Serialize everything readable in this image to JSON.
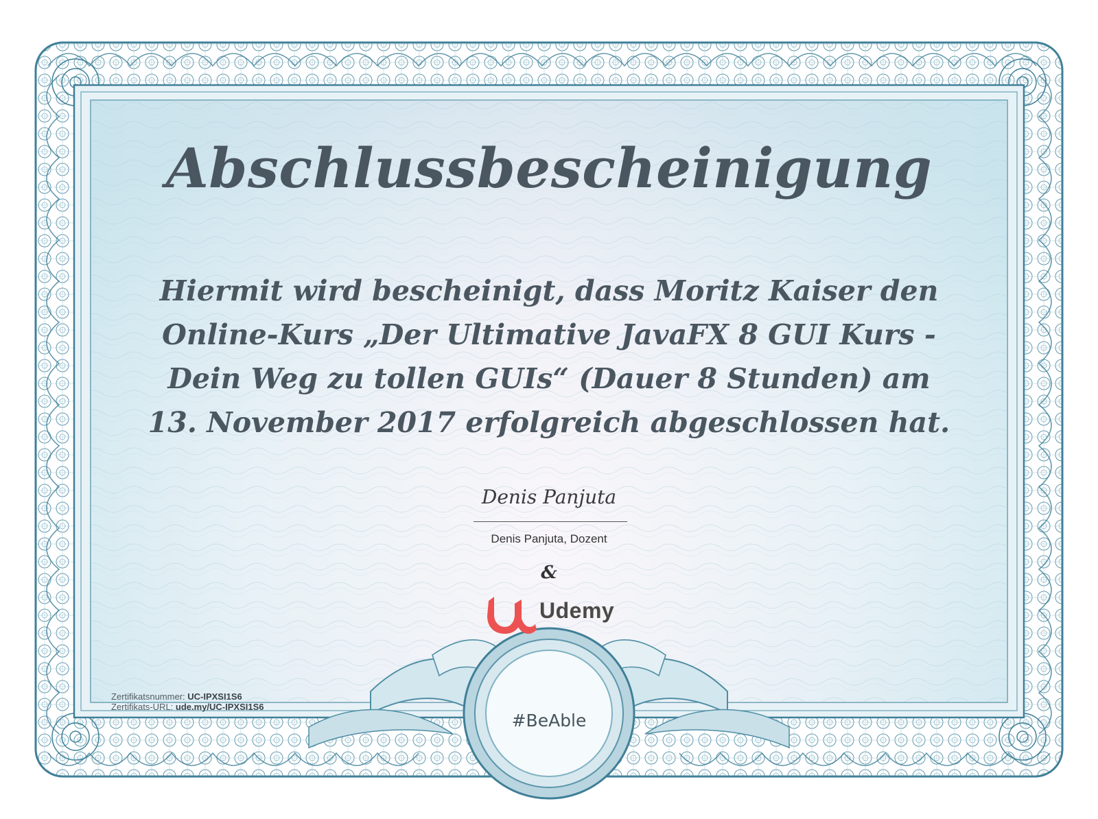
{
  "certificate": {
    "title": "Abschlussbescheinigung",
    "body_lines": [
      "Hiermit wird bescheinigt, dass Moritz Kaiser den",
      "Online-Kurs „Der Ultimative JavaFX 8 GUI Kurs -",
      "Dein Weg zu tollen GUIs“ (Dauer 8 Stunden) am",
      "13. November 2017 erfolgreich abgeschlossen hat."
    ],
    "signature_script": "Denis Panjuta",
    "signature_caption": "Denis Panjuta, Dozent",
    "ampersand": "&",
    "brand_name": "Udemy",
    "certificate_number_label": "Zertifikatsnummer: ",
    "certificate_number": "UC-IPXSI1S6",
    "certificate_url_label": "Zertifikats-URL: ",
    "certificate_url": "ude.my/UC-IPXSI1S6",
    "seal_text": "#BeAble"
  },
  "colors": {
    "frame_outer": "#3f7f98",
    "frame_inner": "#6aa3b8",
    "panel": "#dcedf3",
    "text": "#4a5660",
    "udemy_red": "#ec5252",
    "udemy_text": "#4c4a47"
  },
  "icons": {
    "brand_mark": "udemy-u-icon",
    "seal": "ribbon-seal-icon"
  }
}
